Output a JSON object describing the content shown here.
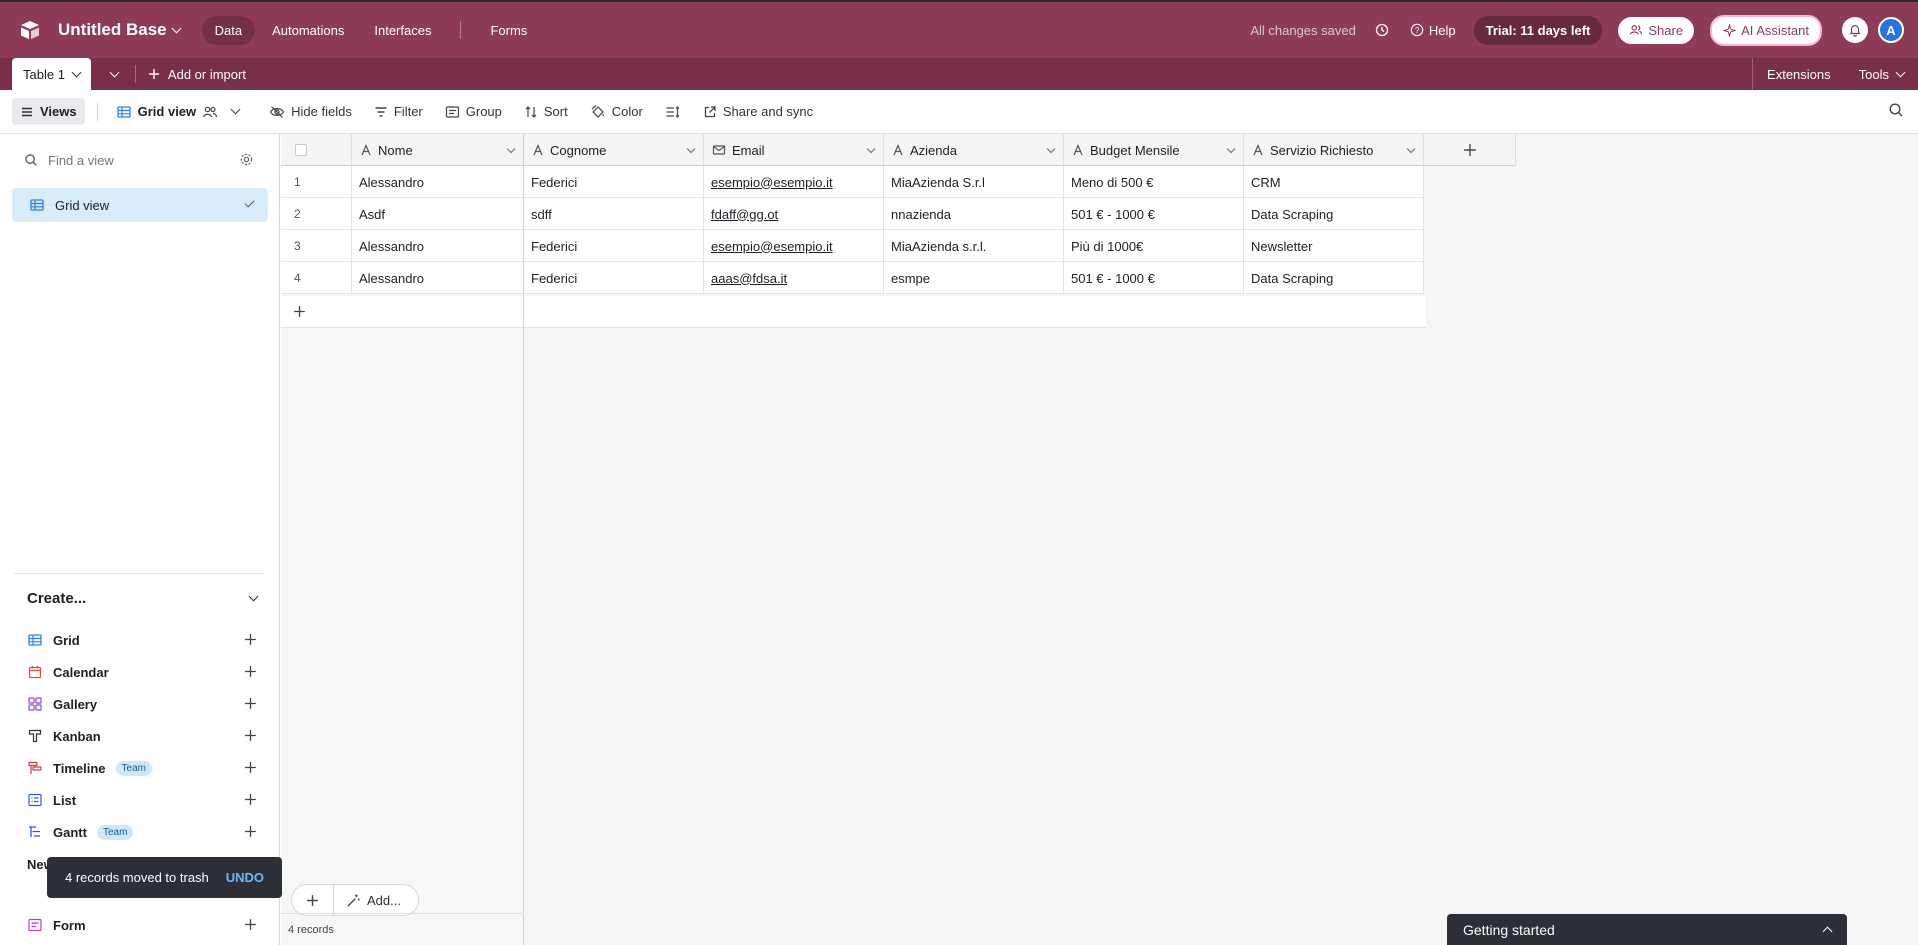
{
  "header": {
    "base_name": "Untitled Base",
    "nav": [
      "Data",
      "Automations",
      "Interfaces",
      "Forms"
    ],
    "status": "All changes saved",
    "help": "Help",
    "trial": "Trial: 11 days left",
    "share": "Share",
    "ai_assistant": "AI Assistant",
    "avatar_initial": "A"
  },
  "tabbar": {
    "active_table": "Table 1",
    "add_import": "Add or import",
    "extensions": "Extensions",
    "tools": "Tools"
  },
  "toolbar": {
    "views": "Views",
    "grid_view": "Grid view",
    "hide_fields": "Hide fields",
    "filter": "Filter",
    "group": "Group",
    "sort": "Sort",
    "color": "Color",
    "share_sync": "Share and sync"
  },
  "sidebar": {
    "find_placeholder": "Find a view",
    "current_view": "Grid view",
    "create_label": "Create...",
    "create_items": [
      {
        "label": "Grid",
        "icon": "grid-icon",
        "color": "#2d7ff9"
      },
      {
        "label": "Calendar",
        "icon": "calendar-icon",
        "color": "#e04a4a"
      },
      {
        "label": "Gallery",
        "icon": "gallery-icon",
        "color": "#8b46d6"
      },
      {
        "label": "Kanban",
        "icon": "kanban-icon",
        "color": "#1d1f25"
      },
      {
        "label": "Timeline",
        "icon": "timeline-icon",
        "color": "#d9304a",
        "badge": "Team"
      },
      {
        "label": "List",
        "icon": "list-icon",
        "color": "#2d5fb8"
      },
      {
        "label": "Gantt",
        "icon": "gantt-icon",
        "color": "#2d5fb8",
        "badge": "Team"
      },
      {
        "label": "Form",
        "icon": "form-icon",
        "color": "#c23fb4"
      }
    ],
    "new_label_peek": "New"
  },
  "grid": {
    "columns": [
      "Nome",
      "Cognome",
      "Email",
      "Azienda",
      "Budget Mensile",
      "Servizio Richiesto"
    ],
    "rows": [
      {
        "num": "1",
        "nome": "Alessandro",
        "cognome": "Federici",
        "email": "esempio@esempio.it",
        "azienda": "MiaAzienda S.r.l",
        "budget": "Meno di 500 €",
        "servizio": "CRM"
      },
      {
        "num": "2",
        "nome": "Asdf",
        "cognome": "sdff",
        "email": "fdaff@gg.ot",
        "azienda": "nnazienda",
        "budget": "501 € - 1000 €",
        "servizio": "Data Scraping"
      },
      {
        "num": "3",
        "nome": "Alessandro",
        "cognome": "Federici",
        "email": "esempio@esempio.it",
        "azienda": "MiaAzienda s.r.l.",
        "budget": "Più di 1000€",
        "servizio": "Newsletter"
      },
      {
        "num": "4",
        "nome": "Alessandro",
        "cognome": "Federici",
        "email": "aaas@fdsa.it",
        "azienda": "esmpe",
        "budget": "501 € - 1000 €",
        "servizio": "Data Scraping"
      }
    ],
    "records_count": "4 records",
    "add_label": "Add..."
  },
  "toast": {
    "message": "4 records moved to trash",
    "action": "UNDO"
  },
  "getting_started": "Getting started",
  "colors": {
    "brand": "#8e3b55",
    "brand_dark": "#7a2f49",
    "selected_view": "#d8ecf9"
  }
}
